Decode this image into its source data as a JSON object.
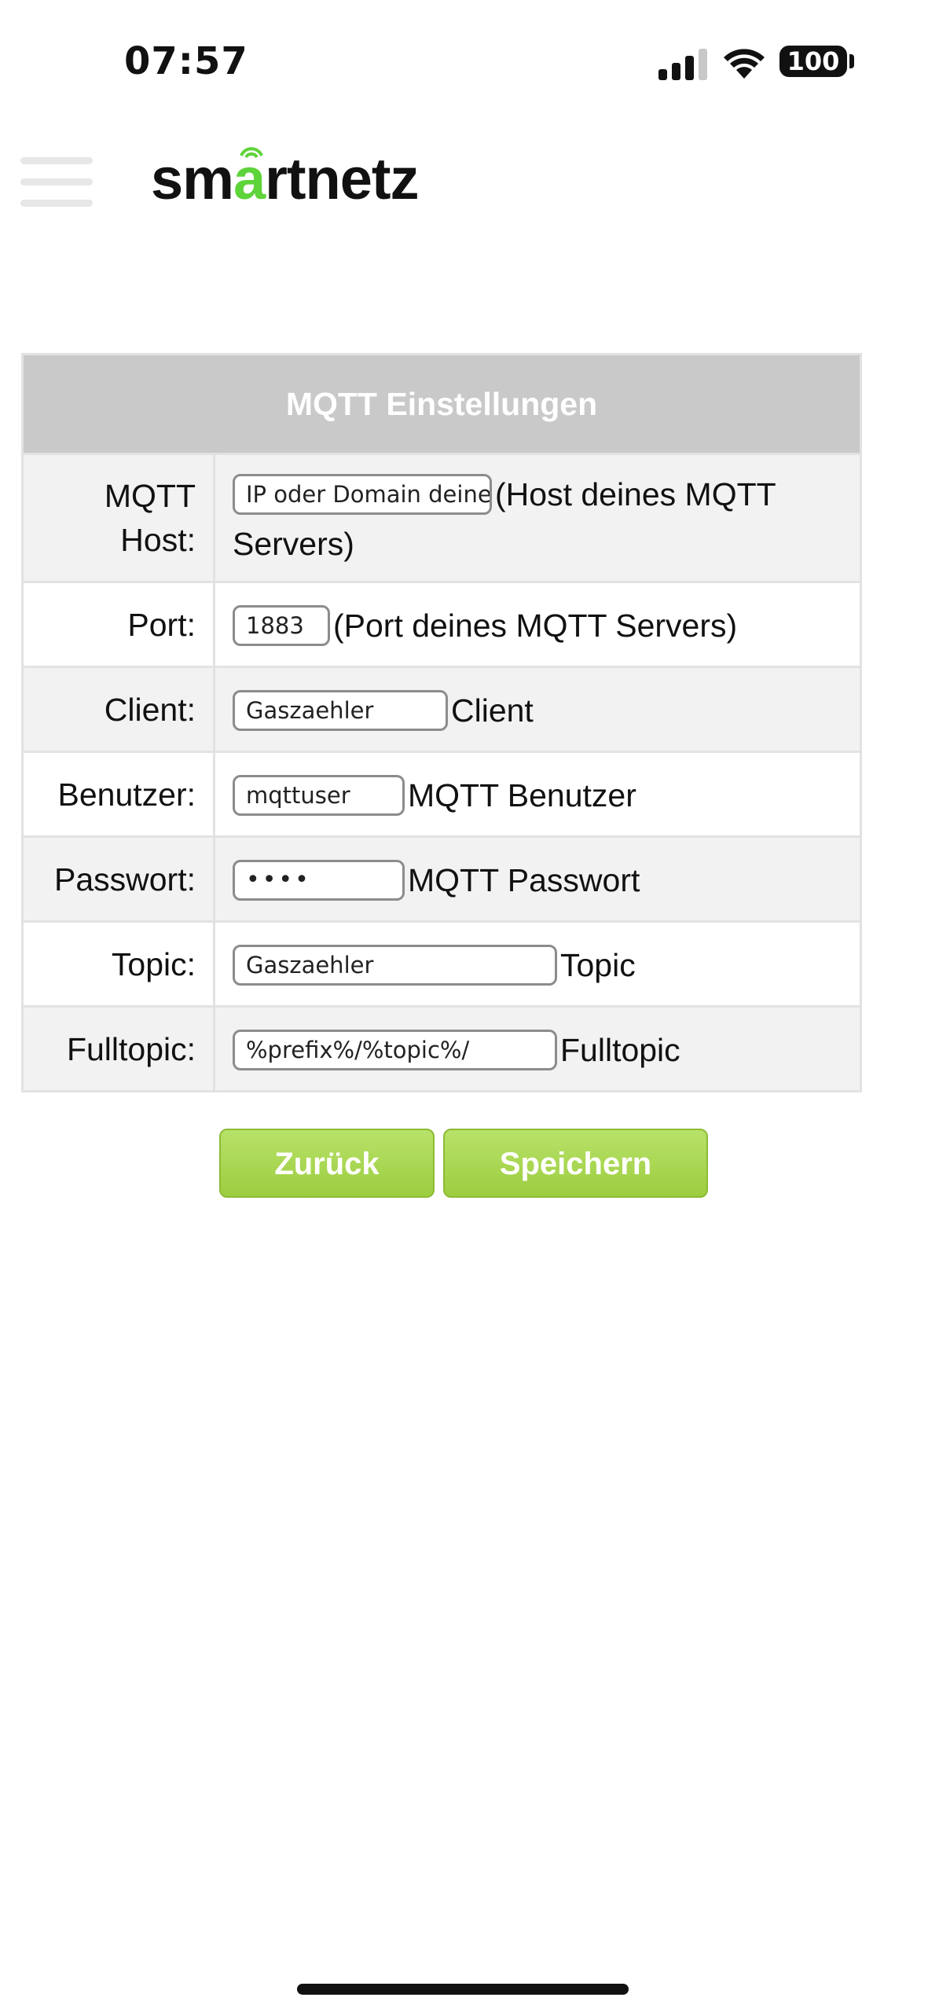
{
  "status_bar": {
    "time": "07:57",
    "battery": "100"
  },
  "header": {
    "logo_prefix": "sm",
    "logo_accent": "a",
    "logo_suffix": "rtnetz",
    "accent_color": "#5ed33a"
  },
  "form": {
    "title": "MQTT Einstellungen",
    "rows": [
      {
        "label": "MQTT Host:",
        "value": "IP oder Domain deines",
        "description": "(Host deines MQTT Servers)"
      },
      {
        "label": "Port:",
        "value": "1883",
        "description": "(Port deines MQTT Servers)"
      },
      {
        "label": "Client:",
        "value": "Gaszaehler",
        "description": "Client"
      },
      {
        "label": "Benutzer:",
        "value": "mqttuser",
        "description": "MQTT Benutzer"
      },
      {
        "label": "Passwort:",
        "value": "••••",
        "description": "MQTT Passwort"
      },
      {
        "label": "Topic:",
        "value": "Gaszaehler",
        "description": "Topic"
      },
      {
        "label": "Fulltopic:",
        "value": "%prefix%/%topic%/",
        "description": "Fulltopic"
      }
    ]
  },
  "buttons": {
    "back": "Zurück",
    "save": "Speichern",
    "button_color": "#a8d650"
  }
}
